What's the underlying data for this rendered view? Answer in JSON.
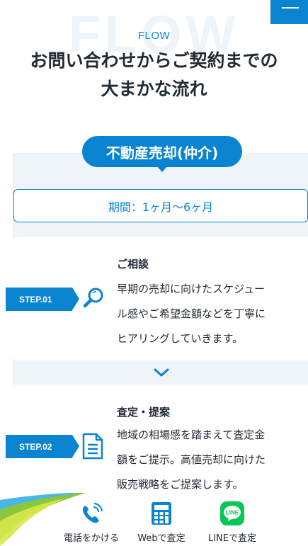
{
  "header": {
    "bg_word": "FLOW",
    "section_label": "FLOW",
    "heading_lines": [
      "お問い合わせからご契約までの",
      "大まかな流れ"
    ]
  },
  "category": {
    "label": "不動産売却(仲介)"
  },
  "period": {
    "label": "期間：1ヶ月〜6ヶ月"
  },
  "steps": [
    {
      "tag": "STEP.01",
      "icon": "magnifier-icon",
      "title": "ご相談",
      "lines": [
        "早期の売却に向けたスケジュー",
        "ル感やご希望金額などを丁寧に",
        "ヒアリングしていきます。"
      ]
    },
    {
      "tag": "STEP.02",
      "icon": "document-icon",
      "title": "査定・提案",
      "lines": [
        "地域の相場感を踏まえて査定金",
        "額をご提示。高値売却に向けた",
        "販売戦略をご提案します。"
      ]
    }
  ],
  "bottom_nav": [
    {
      "label": "電話をかける",
      "icon": "phone-icon"
    },
    {
      "label": "Webで査定",
      "icon": "calculator-icon"
    },
    {
      "label": "LINEで査定",
      "icon": "line-icon",
      "icon_text": "LINE"
    }
  ],
  "colors": {
    "accent": "#0a84d0",
    "bg_gray": "#eff4f8",
    "text": "#222b35",
    "line_green": "#06c755"
  }
}
